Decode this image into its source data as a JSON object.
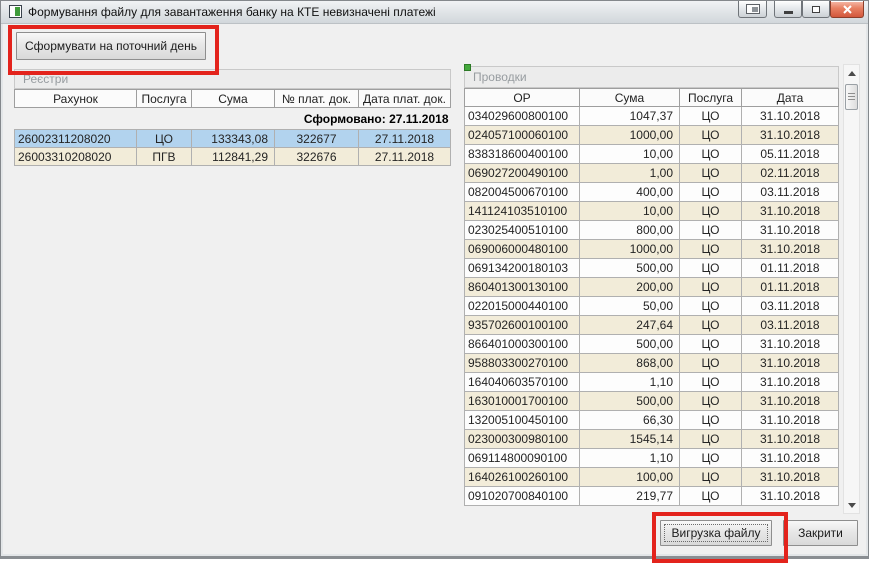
{
  "window": {
    "title": "Формування файлу для завантаження банку на КТЕ невизначені платежі"
  },
  "toolbar": {
    "generate_button": "Сформувати на поточний день"
  },
  "registries": {
    "panel_title": "Реєстри",
    "columns": [
      "Рахунок",
      "Послуга",
      "Сума",
      "№ плат. док.",
      "Дата плат. док."
    ],
    "formed_label": "Сформовано: 27.11.2018",
    "rows": [
      {
        "account": "26002311208020",
        "service": "ЦО",
        "sum": "133343,08",
        "doc_no": "322677",
        "doc_date": "27.11.2018",
        "selected": true
      },
      {
        "account": "26003310208020",
        "service": "ПГВ",
        "sum": "112841,29",
        "doc_no": "322676",
        "doc_date": "27.11.2018",
        "selected": false
      }
    ]
  },
  "transactions": {
    "panel_title": "Проводки",
    "columns": [
      "ОР",
      "Сума",
      "Послуга",
      "Дата"
    ],
    "rows": [
      [
        "034029600800100",
        "1047,37",
        "ЦО",
        "31.10.2018"
      ],
      [
        "024057100060100",
        "1000,00",
        "ЦО",
        "31.10.2018"
      ],
      [
        "838318600400100",
        "10,00",
        "ЦО",
        "05.11.2018"
      ],
      [
        "069027200490100",
        "1,00",
        "ЦО",
        "02.11.2018"
      ],
      [
        "082004500670100",
        "400,00",
        "ЦО",
        "03.11.2018"
      ],
      [
        "141124103510100",
        "10,00",
        "ЦО",
        "31.10.2018"
      ],
      [
        "023025400510100",
        "800,00",
        "ЦО",
        "31.10.2018"
      ],
      [
        "069006000480100",
        "1000,00",
        "ЦО",
        "31.10.2018"
      ],
      [
        "069134200180103",
        "500,00",
        "ЦО",
        "01.11.2018"
      ],
      [
        "860401300130100",
        "200,00",
        "ЦО",
        "01.11.2018"
      ],
      [
        "022015000440100",
        "50,00",
        "ЦО",
        "03.11.2018"
      ],
      [
        "935702600100100",
        "247,64",
        "ЦО",
        "03.11.2018"
      ],
      [
        "866401000300100",
        "500,00",
        "ЦО",
        "31.10.2018"
      ],
      [
        "958803300270100",
        "868,00",
        "ЦО",
        "31.10.2018"
      ],
      [
        "164040603570100",
        "1,10",
        "ЦО",
        "31.10.2018"
      ],
      [
        "163010001700100",
        "500,00",
        "ЦО",
        "31.10.2018"
      ],
      [
        "132005100450100",
        "66,30",
        "ЦО",
        "31.10.2018"
      ],
      [
        "023000300980100",
        "1545,14",
        "ЦО",
        "31.10.2018"
      ],
      [
        "069114800090100",
        "1,10",
        "ЦО",
        "31.10.2018"
      ],
      [
        "164026100260100",
        "100,00",
        "ЦО",
        "31.10.2018"
      ],
      [
        "091020700840100",
        "219,77",
        "ЦО",
        "31.10.2018"
      ]
    ]
  },
  "footer": {
    "export_button": "Вигрузка файлу",
    "close_button": "Закрити"
  },
  "colors": {
    "selection_blue": "#b2d3ee",
    "zebra_beige": "#f2ecd9",
    "annotation_red": "#e3231c",
    "panel_icon_green": "#44a93c",
    "close_button_red": "#d2573c",
    "dialog_background": "#f0f0f0"
  },
  "icons": {
    "app_icon": "green-white square logo",
    "window_mode_icon": "window with docked pane",
    "minimize_icon": "horizontal bar",
    "restore_icon": "square outline",
    "close_icon": "x cross",
    "scroll_up_icon": "triangle up",
    "scroll_down_icon": "triangle down"
  }
}
